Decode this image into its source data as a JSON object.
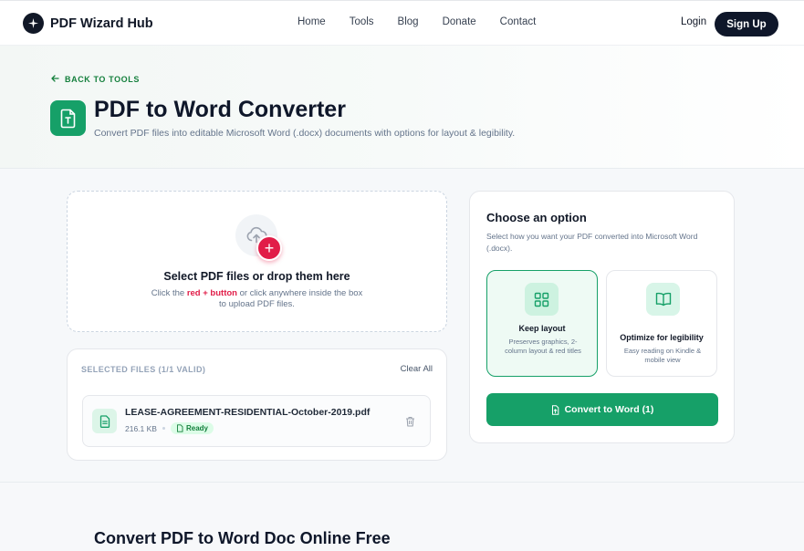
{
  "header": {
    "logo_text": "PDF Wizard Hub",
    "nav": [
      "Home",
      "Tools",
      "Blog",
      "Donate",
      "Contact"
    ],
    "login": "Login",
    "signup": "Sign Up"
  },
  "hero": {
    "back_label": "BACK TO TOOLS",
    "title": "PDF to Word Converter",
    "subtitle": "Convert PDF files into editable Microsoft Word (.docx) documents with options for layout & legibility."
  },
  "upload": {
    "title": "Select PDF files or drop them here",
    "hint_prefix": "Click the ",
    "hint_highlight": "red + button",
    "hint_suffix": " or click anywhere inside the box",
    "hint_line2": "to upload PDF files."
  },
  "files": {
    "heading": "SELECTED FILES (1/1 VALID)",
    "clear_all": "Clear All",
    "items": [
      {
        "name": "LEASE-AGREEMENT-RESIDENTIAL-October-2019.pdf",
        "size": "216.1 KB",
        "status": "Ready"
      }
    ]
  },
  "options": {
    "title": "Choose an option",
    "subtitle": "Select how you want your PDF converted into Microsoft Word (.docx).",
    "cards": [
      {
        "name": "Keep layout",
        "desc": "Preserves graphics, 2-column layout & red titles",
        "selected": true,
        "icon": "grid-icon"
      },
      {
        "name": "Optimize for legibility",
        "desc": "Easy reading on Kindle & mobile view",
        "selected": false,
        "icon": "book-icon"
      }
    ],
    "convert_label": "Convert to Word (1)"
  },
  "bottom": {
    "title": "Convert PDF to Word Doc Online Free"
  },
  "colors": {
    "accent": "#16a068",
    "danger": "#e11d48",
    "dark": "#0f172a"
  }
}
